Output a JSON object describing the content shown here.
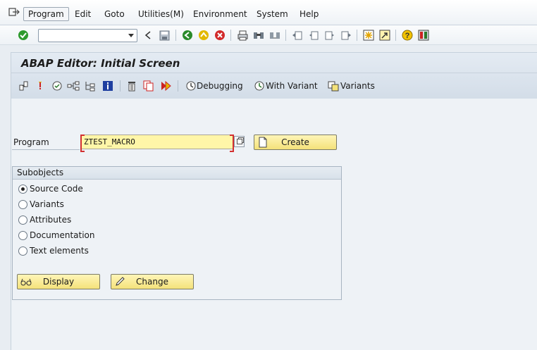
{
  "menu": {
    "items": [
      {
        "label": "Program",
        "active": true
      },
      {
        "label": "Edit"
      },
      {
        "label": "Goto"
      },
      {
        "label": "Utilities(M)"
      },
      {
        "label": "Environment"
      },
      {
        "label": "System"
      },
      {
        "label": "Help"
      }
    ]
  },
  "toolbar": {
    "command_field_value": "",
    "icons": [
      "enter-icon",
      "back-icon",
      "save-icon",
      "back-nav-icon",
      "exit-icon",
      "cancel-icon",
      "print-icon",
      "find-icon",
      "find-next-icon",
      "first-page-icon",
      "previous-page-icon",
      "next-page-icon",
      "last-page-icon",
      "create-session-icon",
      "shortcut-icon",
      "help-icon",
      "customize-layout-icon"
    ]
  },
  "screen": {
    "title": "ABAP Editor: Initial Screen"
  },
  "app_toolbar": {
    "debugging_label": "Debugging",
    "with_variant_label": "With Variant",
    "variants_label": "Variants"
  },
  "form": {
    "program_label": "Program",
    "program_value": "ZTEST_MACRO",
    "create_label": "Create"
  },
  "subobjects": {
    "title": "Subobjects",
    "options": [
      {
        "label": "Source Code",
        "selected": true
      },
      {
        "label": "Variants",
        "selected": false
      },
      {
        "label": "Attributes",
        "selected": false
      },
      {
        "label": "Documentation",
        "selected": false
      },
      {
        "label": "Text elements",
        "selected": false
      }
    ],
    "display_label": "Display",
    "change_label": "Change"
  },
  "colors": {
    "input_highlight": "#fff6a8",
    "button_fill": "#f4e27a",
    "required_marker": "#d23030"
  }
}
